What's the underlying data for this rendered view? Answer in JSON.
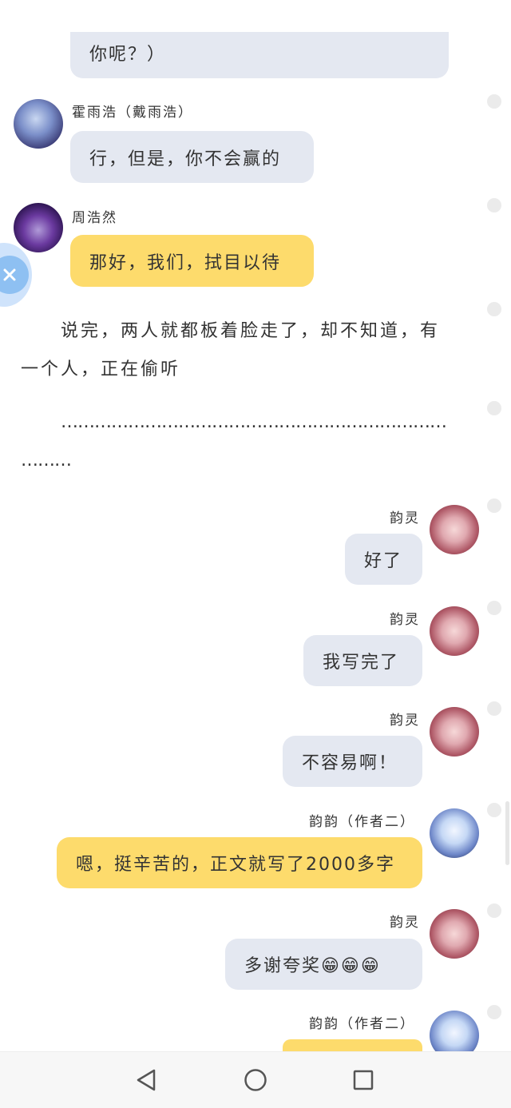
{
  "messages": [
    {
      "text": "你呢？）"
    },
    {
      "sender": "霍雨浩（戴雨浩）",
      "text": "行，但是，你不会赢的"
    },
    {
      "sender": "周浩然",
      "text": "那好，我们，拭目以待"
    },
    {
      "sender": "韵灵",
      "text": "好了"
    },
    {
      "sender": "韵灵",
      "text": "我写完了"
    },
    {
      "sender": "韵灵",
      "text": "不容易啊！"
    },
    {
      "sender": "韵韵（作者二）",
      "text": "嗯，挺辛苦的，正文就写了2000多字"
    },
    {
      "sender": "韵灵",
      "text": "多谢夸奖😁😁😁"
    },
    {
      "sender": "韵韵（作者二）",
      "text": ""
    }
  ],
  "narration": {
    "line1": "说完，两人就都板着脸走了，却不知道，有",
    "line2": "一个人，正在偷听",
    "ellipsis1": "……………………………………………………………",
    "ellipsis2": "………"
  },
  "icons": {
    "floating": "close-x-icon",
    "nav_back": "triangle-back-icon",
    "nav_home": "circle-home-icon",
    "nav_recent": "square-recent-icon"
  },
  "colors": {
    "gray_bubble": "#e4e8f1",
    "yellow_bubble": "#fddb6c",
    "text": "#333333"
  }
}
